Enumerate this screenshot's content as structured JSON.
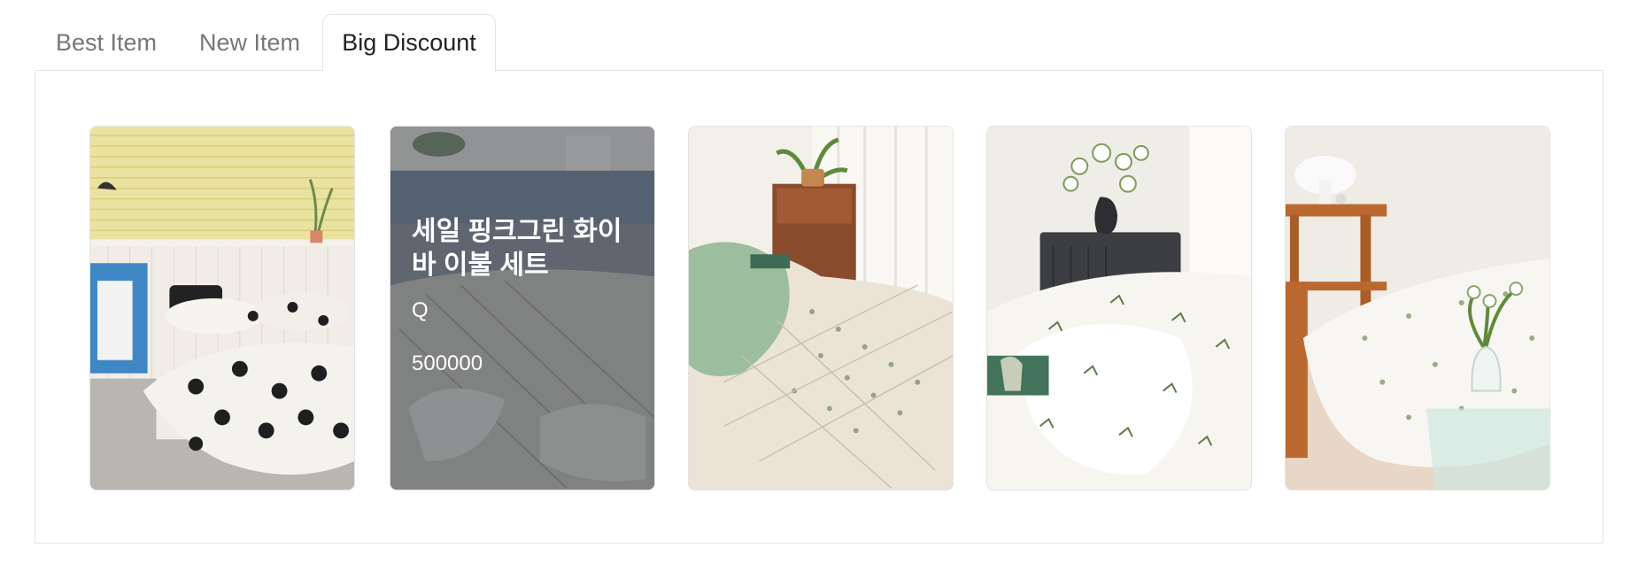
{
  "tabs": [
    {
      "label": "Best Item",
      "active": false
    },
    {
      "label": "New Item",
      "active": false
    },
    {
      "label": "Big Discount",
      "active": true
    }
  ],
  "products": [
    {
      "image": "bedroom with black floral quilt and yellow window blinds"
    },
    {
      "image": "grey striped bedding in a room",
      "name": "세일 핑크그린 화이바 이불 세트",
      "subtitle": "Q",
      "price": "500000",
      "hovered": true
    },
    {
      "image": "green and white patterned quilt beside wooden nightstand with plant"
    },
    {
      "image": "white bedding with green leaf print and flowers on dark nightstand"
    },
    {
      "image": "white floral bedding with wooden desk, lamp and vase on glass table"
    }
  ],
  "colors": {
    "tab_border": "#e3e3e3",
    "panel_border": "#e6e6e6",
    "overlay": "rgba(40,44,50,0.45)"
  }
}
